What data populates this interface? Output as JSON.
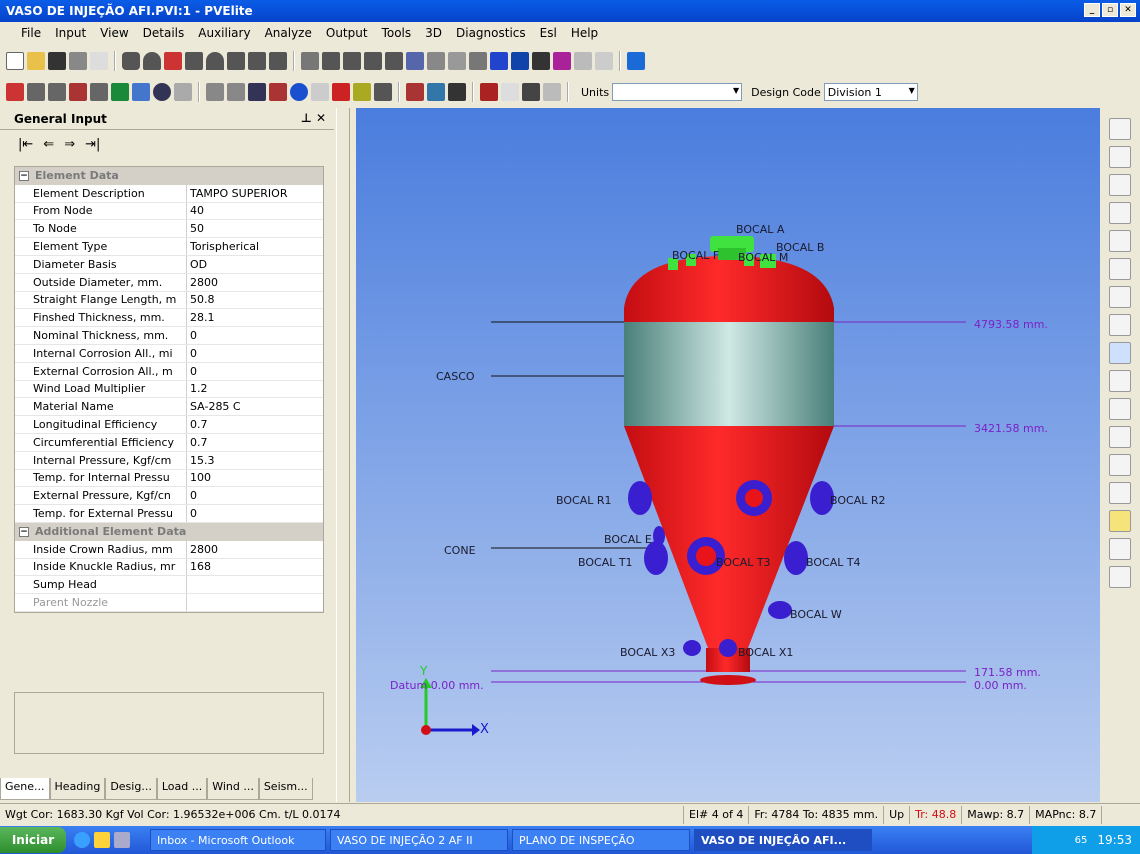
{
  "window": {
    "title": "VASO DE INJEÇÃO AFI.PVI:1 - PVElite"
  },
  "menu": [
    "File",
    "Input",
    "View",
    "Details",
    "Auxiliary",
    "Analyze",
    "Output",
    "Tools",
    "3D",
    "Diagnostics",
    "Esl",
    "Help"
  ],
  "toolbar": {
    "units_label": "Units",
    "units_value": "",
    "design_code_label": "Design Code",
    "design_code_value": "Division 1"
  },
  "panel": {
    "title": "General Input",
    "nav_icons": [
      "first-icon",
      "prev-icon",
      "next-icon",
      "last-icon"
    ],
    "group1": "Element Data",
    "rows": [
      {
        "k": "Element Description",
        "v": "TAMPO SUPERIOR"
      },
      {
        "k": "From Node",
        "v": "40"
      },
      {
        "k": "To Node",
        "v": "50"
      },
      {
        "k": "Element Type",
        "v": "Torispherical"
      },
      {
        "k": "Diameter Basis",
        "v": "OD"
      },
      {
        "k": "Outside Diameter, mm.",
        "v": "2800"
      },
      {
        "k": "Straight Flange Length, m",
        "v": "50.8"
      },
      {
        "k": "Finshed Thickness, mm.",
        "v": "28.1"
      },
      {
        "k": "Nominal Thickness, mm.",
        "v": "0"
      },
      {
        "k": "Internal Corrosion All., mi",
        "v": "0"
      },
      {
        "k": "External Corrosion All., m",
        "v": "0"
      },
      {
        "k": "Wind Load Multiplier",
        "v": "1.2"
      },
      {
        "k": "Material Name",
        "v": "SA-285 C"
      },
      {
        "k": "Longitudinal Efficiency",
        "v": "0.7"
      },
      {
        "k": "Circumferential Efficiency",
        "v": "0.7"
      },
      {
        "k": "Internal Pressure, Kgf/cm",
        "v": "15.3"
      },
      {
        "k": "Temp. for Internal Pressu",
        "v": "100"
      },
      {
        "k": "External Pressure, Kgf/cn",
        "v": "0"
      },
      {
        "k": "Temp. for External Pressu",
        "v": "0"
      }
    ],
    "group2": "Additional Element Data",
    "rows2": [
      {
        "k": "Inside Crown Radius, mm",
        "v": "2800"
      },
      {
        "k": "Inside Knuckle Radius, mr",
        "v": "168"
      },
      {
        "k": "Sump Head",
        "v": ""
      },
      {
        "k": "Parent Nozzle",
        "v": ""
      }
    ],
    "tabs": [
      "Gene...",
      "Heading",
      "Desig...",
      "Load ...",
      "Wind ...",
      "Seism..."
    ]
  },
  "view": {
    "labels": {
      "bocal_a": "BOCAL A",
      "bocal_b": "BOCAL B",
      "bocal_f": "BOCAL F",
      "bocal_m": "BOCAL M",
      "casco": "CASCO",
      "cone": "CONE",
      "bocal_r1": "BOCAL R1",
      "bocal_r2": "BOCAL R2",
      "bocal_e": "BOCAL E",
      "bocal_t1": "BOCAL T1",
      "bocal_t3": "BOCAL T3",
      "bocal_t4": "BOCAL T4",
      "bocal_w": "BOCAL W",
      "bocal_x3": "BOCAL X3",
      "bocal_x1": "BOCAL X1",
      "dim1": "4793.58 mm.",
      "dim2": "3421.58 mm.",
      "dim3": "171.58 mm.",
      "dim4": "0.00 mm.",
      "datum": "Datum 0.00 mm.",
      "axis_x": "X",
      "axis_y": "Y"
    },
    "colors": {
      "vessel": "#e8141a",
      "shell": "#7fb7b0",
      "nozzle": "#3a1fd0",
      "top_nozzle": "#3fe23f",
      "dim": "#7b22c6"
    }
  },
  "status": {
    "weights": "Wgt Cor: 1683.30 Kgf  Vol Cor: 1.96532e+006 Cm.  t/L 0.0174",
    "el": "El# 4 of 4",
    "fr": "Fr: 4784 To: 4835 mm.",
    "up": "Up",
    "tr": "Tr: 48.8",
    "mawp": "Mawp: 8.7",
    "mapnc": "MAPnc: 8.7"
  },
  "taskbar": {
    "start": "Iniciar",
    "tasks": [
      "Inbox - Microsoft Outlook",
      "VASO DE INJEÇÃO 2 AF II",
      "PLANO DE INSPEÇÃO",
      "VASO DE INJEÇÃO AFI..."
    ],
    "time": "19:53",
    "tray_num": "65"
  }
}
